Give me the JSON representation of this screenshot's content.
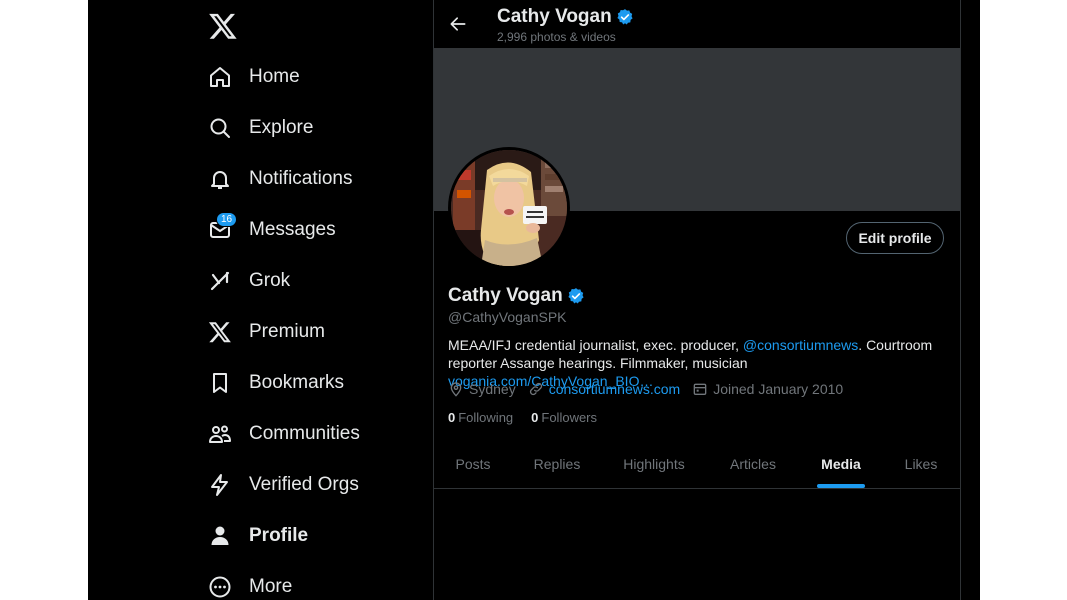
{
  "sidebar": {
    "logo_icon": "x-logo-icon",
    "items": [
      {
        "label": "Home",
        "icon": "home-icon"
      },
      {
        "label": "Explore",
        "icon": "search-icon"
      },
      {
        "label": "Notifications",
        "icon": "bell-icon"
      },
      {
        "label": "Messages",
        "icon": "mail-icon",
        "badge": "16"
      },
      {
        "label": "Grok",
        "icon": "grok-icon"
      },
      {
        "label": "Premium",
        "icon": "x-logo-icon"
      },
      {
        "label": "Bookmarks",
        "icon": "bookmark-icon"
      },
      {
        "label": "Communities",
        "icon": "people-icon"
      },
      {
        "label": "Verified Orgs",
        "icon": "lightning-icon"
      },
      {
        "label": "Profile",
        "icon": "person-icon",
        "active": true
      },
      {
        "label": "More",
        "icon": "more-icon"
      }
    ]
  },
  "header": {
    "name": "Cathy Vogan",
    "subtitle": "2,996 photos & videos"
  },
  "profile": {
    "name": "Cathy Vogan",
    "handle": "@CathyVoganSPK",
    "edit_button": "Edit profile",
    "bio_part1": "MEAA/IFJ credential journalist, exec. producer, ",
    "bio_mention": "@consortiumnews",
    "bio_part2": ". Courtroom reporter Assange hearings. Filmmaker, musician ",
    "bio_link": "vogania.com/CathyVogan_BIO…",
    "location": "Sydney",
    "website": "consortiumnews.com",
    "joined": "Joined January 2010",
    "following_count": "0",
    "following_label": "Following",
    "followers_count": "0",
    "followers_label": "Followers"
  },
  "tabs": [
    "Posts",
    "Replies",
    "Highlights",
    "Articles",
    "Media",
    "Likes"
  ],
  "active_tab": "Media",
  "colors": {
    "background": "#000000",
    "accent": "#1d9bf0",
    "banner": "#333639",
    "muted_text": "#71767b",
    "text": "#e7e9ea"
  }
}
